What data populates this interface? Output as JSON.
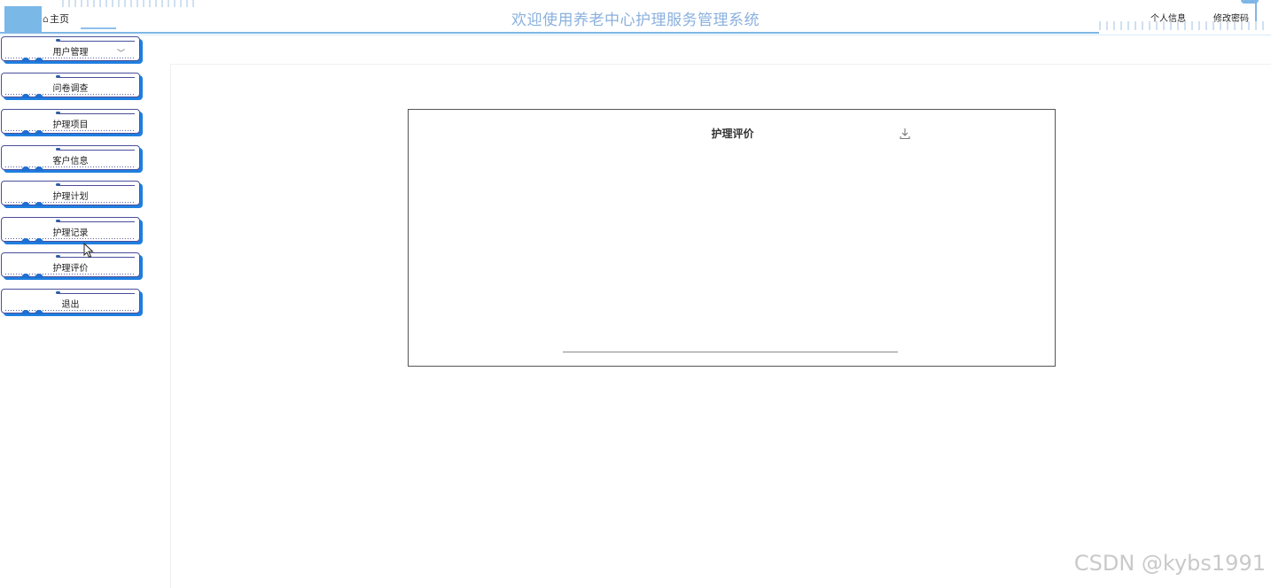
{
  "header": {
    "home_label": "主页",
    "home_icon": "home-icon",
    "title": "欢迎使用养老中心护理服务管理系统",
    "links": {
      "profile": "个人信息",
      "change_password": "修改密码"
    },
    "accent_color": "#7fb6e6"
  },
  "sidebar": {
    "items": [
      {
        "label": "用户管理",
        "has_dropdown": true
      },
      {
        "label": "问卷调查"
      },
      {
        "label": "护理项目"
      },
      {
        "label": "客户信息"
      },
      {
        "label": "护理计划"
      },
      {
        "label": "护理记录"
      },
      {
        "label": "护理评价"
      },
      {
        "label": "退出"
      }
    ],
    "item_shadow_color": "#1f7fe0"
  },
  "main": {
    "chart": {
      "title": "护理评价",
      "download_icon": "download-icon"
    }
  },
  "chart_data": {
    "type": "bar",
    "title": "护理评价",
    "categories": [],
    "values": []
  },
  "watermark": "CSDN @kybs1991"
}
